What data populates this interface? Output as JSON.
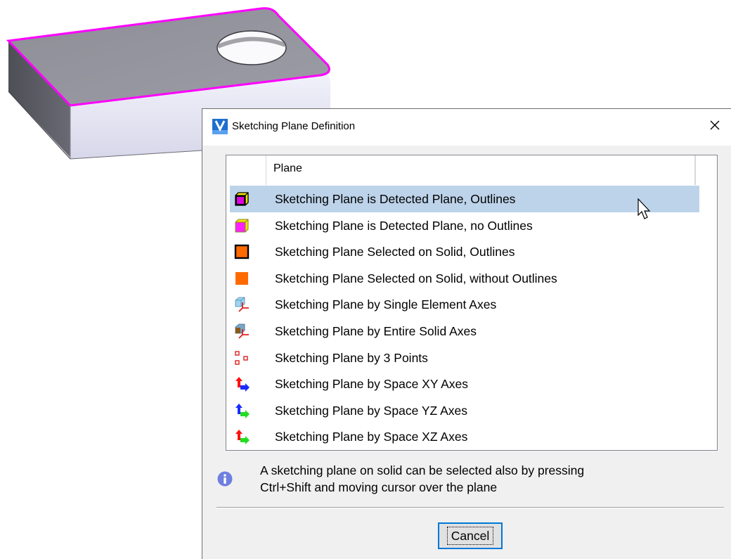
{
  "dialog": {
    "title": "Sketching Plane Definition",
    "app_icon": "v-app-icon",
    "close_icon": "close-icon"
  },
  "list": {
    "column_header": "Plane",
    "selected_index": 0,
    "items": [
      {
        "label": "Sketching Plane is Detected Plane, Outlines",
        "icon": "detected-plane-outlines-icon"
      },
      {
        "label": "Sketching Plane is Detected Plane, no Outlines",
        "icon": "detected-plane-no-outlines-icon"
      },
      {
        "label": "Sketching Plane Selected on Solid, Outlines",
        "icon": "selected-solid-outlines-icon"
      },
      {
        "label": "Sketching Plane Selected on Solid, without Outlines",
        "icon": "selected-solid-no-outlines-icon"
      },
      {
        "label": "Sketching Plane by Single Element Axes",
        "icon": "single-element-axes-icon"
      },
      {
        "label": "Sketching Plane by Entire Solid Axes",
        "icon": "entire-solid-axes-icon"
      },
      {
        "label": "Sketching Plane by 3 Points",
        "icon": "three-points-icon"
      },
      {
        "label": "Sketching Plane by Space XY Axes",
        "icon": "space-xy-axes-icon"
      },
      {
        "label": "Sketching Plane by Space YZ Axes",
        "icon": "space-yz-axes-icon"
      },
      {
        "label": "Sketching Plane by Space XZ Axes",
        "icon": "space-xz-axes-icon"
      }
    ]
  },
  "info": {
    "line1": "A sketching plane on solid can be selected also by pressing",
    "line2": "Ctrl+Shift and moving cursor over the plane"
  },
  "buttons": {
    "cancel": "Cancel"
  },
  "colors": {
    "selection": "#bdd3ea",
    "highlight_edge": "#ff00ff",
    "focus_border": "#0078d7"
  }
}
